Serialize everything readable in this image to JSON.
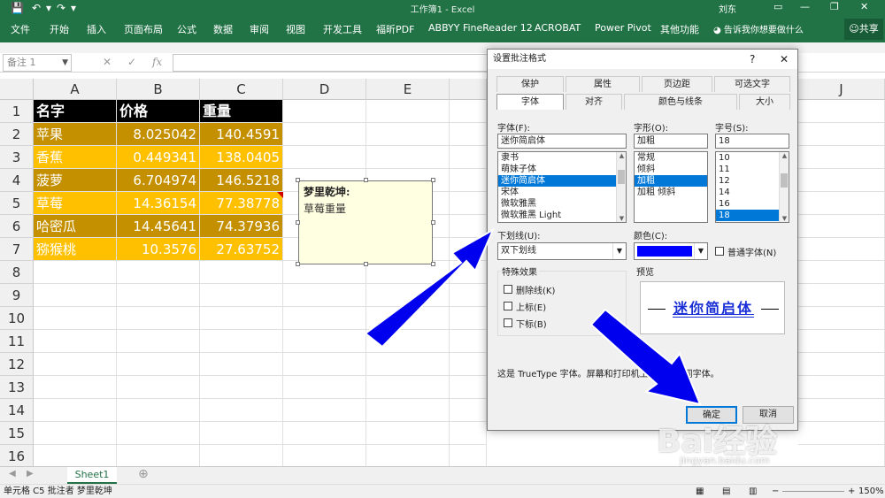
{
  "titlebar": {
    "title": "工作簿1 - Excel",
    "user": "刘东",
    "minimize": "—",
    "restore": "❐",
    "close": "✕"
  },
  "ribbon": {
    "tabs": [
      "文件",
      "开始",
      "插入",
      "页面布局",
      "公式",
      "数据",
      "审阅",
      "视图",
      "开发工具",
      "福昕PDF",
      "ABBYY FineReader 12",
      "ACROBAT",
      "Power Pivot",
      "其他功能",
      "告诉我你想要做什么"
    ],
    "share": "共享"
  },
  "formula_bar": {
    "name_box": "备注 1",
    "fx": "fx",
    "cancel": "✕",
    "confirm": "✓"
  },
  "grid": {
    "columns": [
      "A",
      "B",
      "C",
      "D",
      "E",
      "J"
    ],
    "rows": [
      "1",
      "2",
      "3",
      "4",
      "5",
      "6",
      "7",
      "8",
      "9",
      "10",
      "11",
      "12",
      "13",
      "14",
      "15",
      "16"
    ],
    "header": [
      "名字",
      "价格",
      "重量"
    ],
    "data": [
      [
        "苹果",
        "8.025042",
        "140.4591"
      ],
      [
        "香蕉",
        "0.449341",
        "138.0405"
      ],
      [
        "菠萝",
        "6.704974",
        "146.5218"
      ],
      [
        "草莓",
        "14.36154",
        "77.38778"
      ],
      [
        "哈密瓜",
        "14.45641",
        "74.37936"
      ],
      [
        "猕猴桃",
        "10.3576",
        "27.63752"
      ]
    ]
  },
  "comment": {
    "author": "梦里乾坤:",
    "body": "草莓重量"
  },
  "sheet_tabs": {
    "active": "Sheet1",
    "add": "⊕"
  },
  "status": {
    "text": "单元格 C5 批注者 梦里乾坤",
    "zoom": "150%"
  },
  "dialog": {
    "title": "设置批注格式",
    "help": "?",
    "close": "✕",
    "tabs_row1": [
      "保护",
      "属性",
      "页边距",
      "可选文字"
    ],
    "tabs_row2": [
      "字体",
      "对齐",
      "颜色与线条",
      "大小"
    ],
    "font_label": "字体(F):",
    "font_value": "迷你简启体",
    "font_list": [
      "隶书",
      "萌妹子体",
      "迷你简启体",
      "宋体",
      "微软雅黑",
      "微软雅黑 Light"
    ],
    "style_label": "字形(O):",
    "style_value": "加粗",
    "style_list": [
      "常规",
      "倾斜",
      "加粗",
      "加粗 倾斜"
    ],
    "size_label": "字号(S):",
    "size_value": "18",
    "size_list": [
      "10",
      "11",
      "12",
      "14",
      "16",
      "18"
    ],
    "underline_label": "下划线(U):",
    "underline_value": "双下划线",
    "color_label": "颜色(C):",
    "color_value": "#0000ff",
    "normal_font_label": "普通字体(N)",
    "effects_label": "特殊效果",
    "effects": [
      "删除线(K)",
      "上标(E)",
      "下标(B)"
    ],
    "preview_label": "预览",
    "preview_text": "迷你简启体",
    "info": "这是 TrueType 字体。屏幕和打印机上将使用相同字体。",
    "ok": "确定",
    "cancel": "取消"
  },
  "watermark": {
    "brand": "Bai经验",
    "url": "jingyan.baidu.com"
  },
  "colors": {
    "excel_green": "#217346",
    "dark_gold": "#c49000",
    "gold": "#ffc000",
    "arrow_blue": "#0000ee"
  }
}
